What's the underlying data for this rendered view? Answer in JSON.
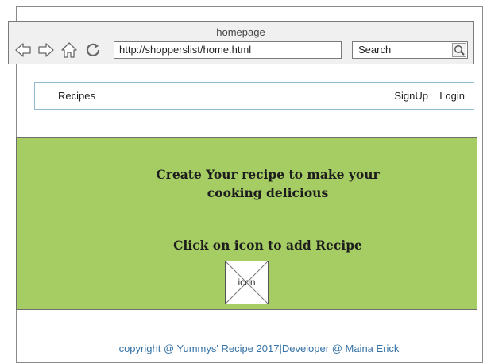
{
  "browser": {
    "title": "homepage",
    "url": "http://shopperslist/home.html",
    "search_placeholder": "Search"
  },
  "navbar": {
    "brand": "Recipes",
    "signup": "SignUp",
    "login": "Login"
  },
  "hero": {
    "heading_line1": "Create Your recipe to make your",
    "heading_line2": "cooking delicious",
    "subheading": "Click on icon to add Recipe",
    "icon_label": "icon",
    "background_color": "#a5cd64"
  },
  "footer": {
    "text": "copyright @ Yummys' Recipe 2017|Developer @ Maina Erick",
    "color": "#3572a6"
  }
}
